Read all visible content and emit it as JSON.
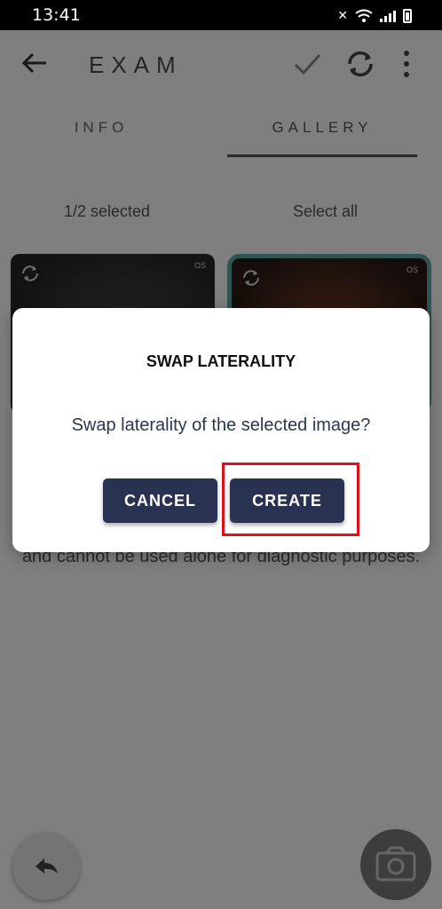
{
  "status_bar": {
    "time": "13:41"
  },
  "header": {
    "title": "EXAM"
  },
  "tabs": [
    {
      "label": "INFO"
    },
    {
      "label": "GALLERY"
    }
  ],
  "selection": {
    "count_text": "1/2 selected",
    "select_all": "Select all"
  },
  "thumbnails": [
    {
      "laterality": "OS",
      "selected": false
    },
    {
      "laterality": "OS",
      "selected": true
    }
  ],
  "disclaimer": {
    "visible_text": "and cannot be used alone for diagnostic purposes."
  },
  "dialog": {
    "title": "SWAP LATERALITY",
    "message": "Swap laterality of the selected image?",
    "cancel_label": "CANCEL",
    "create_label": "CREATE"
  },
  "colors": {
    "button_bg": "#293250",
    "selected_border": "#5fa8a5",
    "highlight": "#e0101a"
  },
  "icons": [
    "back-arrow-icon",
    "check-icon",
    "sync-icon",
    "more-vert-icon",
    "rotate-icon",
    "reply-icon",
    "camera-icon"
  ]
}
